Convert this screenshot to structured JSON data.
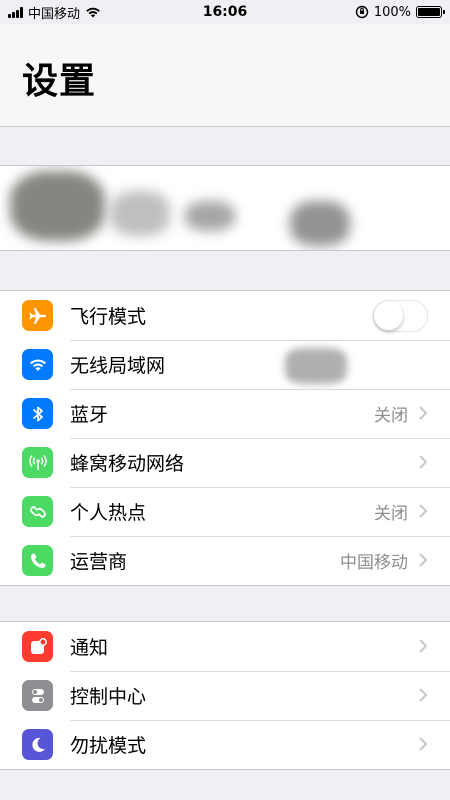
{
  "status_bar": {
    "carrier": "中国移动",
    "time": "16:06",
    "battery": "100%"
  },
  "header": {
    "title": "设置"
  },
  "group1": {
    "items": [
      {
        "label": "飞行模式",
        "value": "",
        "icon": "airplane-icon",
        "color": "#ff9500",
        "toggle_on": false
      },
      {
        "label": "无线局域网",
        "value": "",
        "icon": "wifi-icon",
        "color": "#007aff"
      },
      {
        "label": "蓝牙",
        "value": "关闭",
        "icon": "bluetooth-icon",
        "color": "#007aff"
      },
      {
        "label": "蜂窝移动网络",
        "value": "",
        "icon": "cellular-icon",
        "color": "#4cd964"
      },
      {
        "label": "个人热点",
        "value": "关闭",
        "icon": "hotspot-icon",
        "color": "#4cd964"
      },
      {
        "label": "运营商",
        "value": "中国移动",
        "icon": "phone-icon",
        "color": "#4cd964"
      }
    ]
  },
  "group2": {
    "items": [
      {
        "label": "通知",
        "icon": "notifications-icon",
        "color": "#ff3b30"
      },
      {
        "label": "控制中心",
        "icon": "control-center-icon",
        "color": "#8e8e93"
      },
      {
        "label": "勿扰模式",
        "icon": "moon-icon",
        "color": "#5856d6"
      }
    ]
  }
}
